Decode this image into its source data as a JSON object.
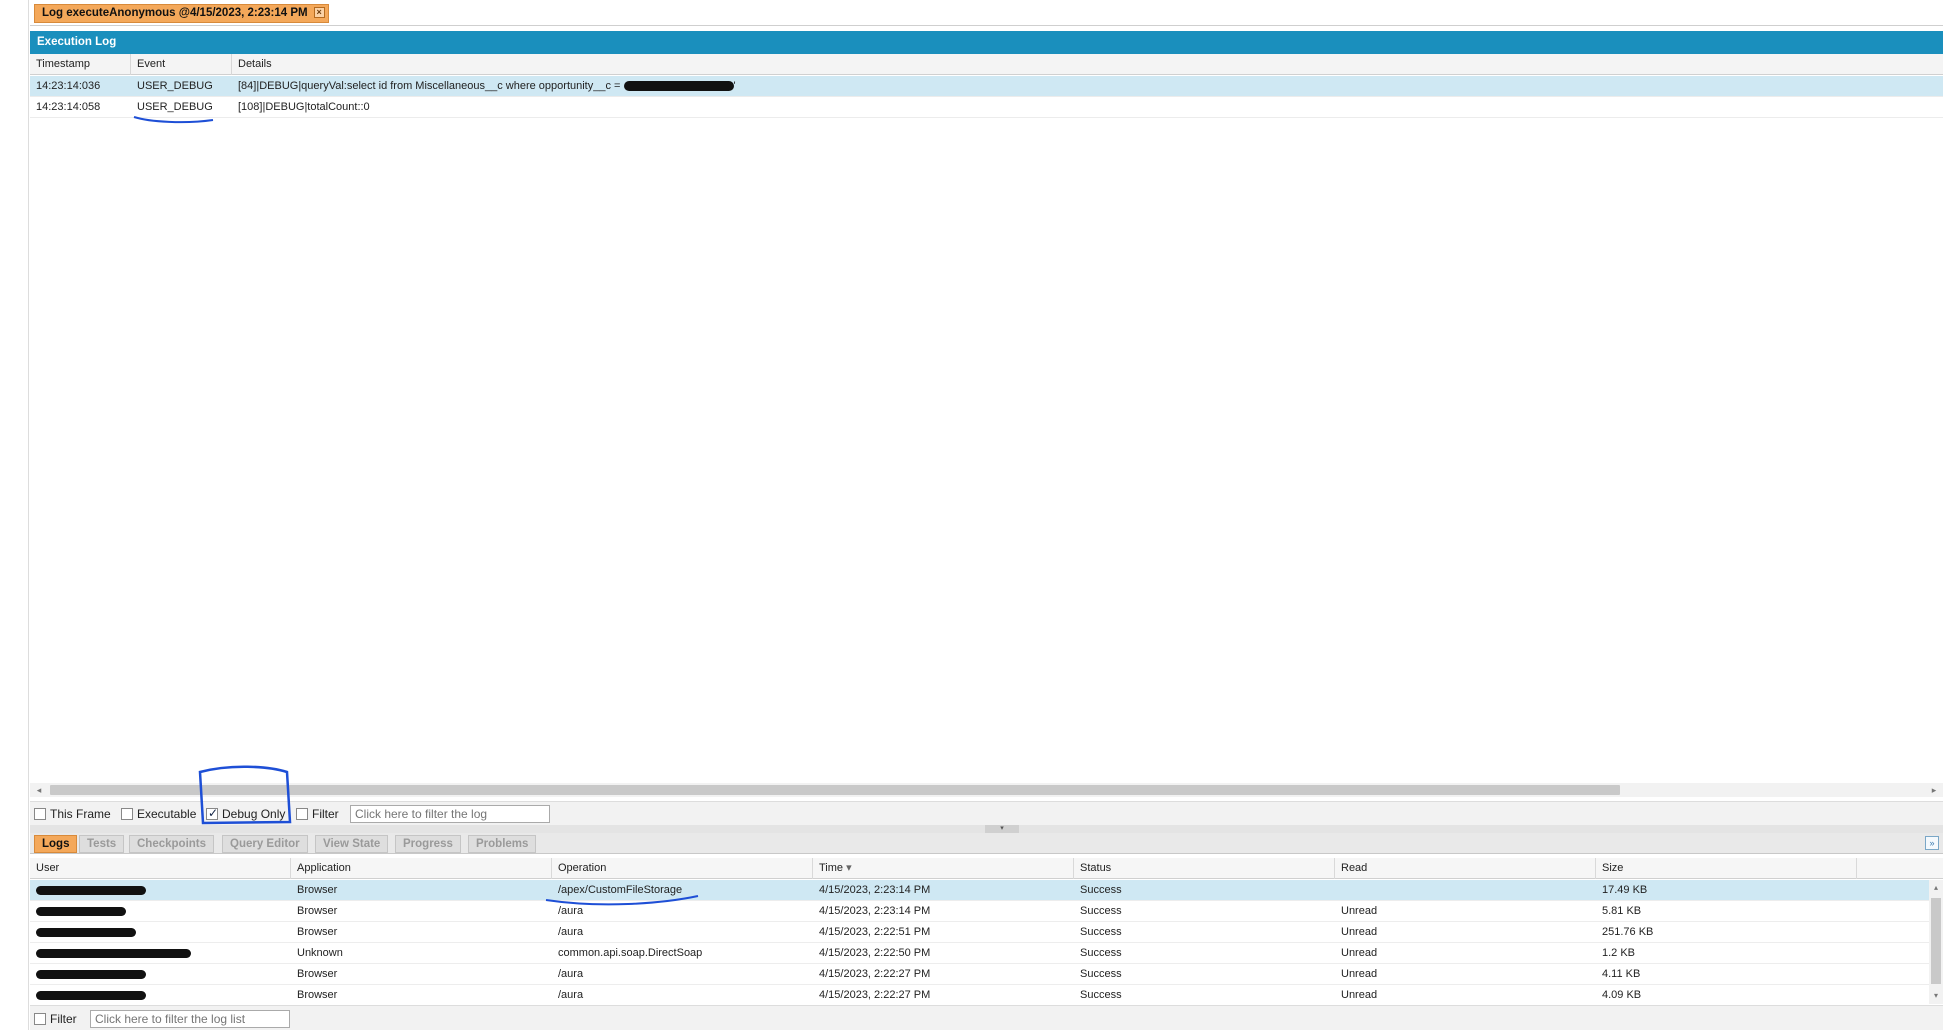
{
  "log_tab": {
    "title": "Log executeAnonymous @4/15/2023, 2:23:14 PM",
    "close": "×"
  },
  "execution_log": {
    "title": "Execution Log",
    "columns": [
      "Timestamp",
      "Event",
      "Details"
    ],
    "rows": [
      {
        "timestamp": "14:23:14:036",
        "event": "USER_DEBUG",
        "details": "[84]|DEBUG|queryVal:select id from Miscellaneous__c where opportunity__c = ",
        "details_tail": "'"
      },
      {
        "timestamp": "14:23:14:058",
        "event": "USER_DEBUG",
        "details": "[108]|DEBUG|totalCount::0"
      }
    ]
  },
  "exec_filters": {
    "this_frame": "This Frame",
    "executable": "Executable",
    "debug_only": "Debug Only",
    "debug_only_checked": true,
    "filter": "Filter",
    "filter_placeholder": "Click here to filter the log"
  },
  "bottom_tabs": [
    "Logs",
    "Tests",
    "Checkpoints",
    "Query Editor",
    "View State",
    "Progress",
    "Problems"
  ],
  "logs_table": {
    "columns": [
      "User",
      "Application",
      "Operation",
      "Time",
      "Status",
      "Read",
      "Size"
    ],
    "sort_indicator": "▾",
    "rows": [
      {
        "application": "Browser",
        "operation": "/apex/CustomFileStorage",
        "time": "4/15/2023, 2:23:14 PM",
        "status": "Success",
        "read": "",
        "size": "17.49 KB"
      },
      {
        "application": "Browser",
        "operation": "/aura",
        "time": "4/15/2023, 2:23:14 PM",
        "status": "Success",
        "read": "Unread",
        "size": "5.81 KB"
      },
      {
        "application": "Browser",
        "operation": "/aura",
        "time": "4/15/2023, 2:22:51 PM",
        "status": "Success",
        "read": "Unread",
        "size": "251.76 KB"
      },
      {
        "application": "Unknown",
        "operation": "common.api.soap.DirectSoap",
        "time": "4/15/2023, 2:22:50 PM",
        "status": "Success",
        "read": "Unread",
        "size": "1.2 KB"
      },
      {
        "application": "Browser",
        "operation": "/aura",
        "time": "4/15/2023, 2:22:27 PM",
        "status": "Success",
        "read": "Unread",
        "size": "4.11 KB"
      },
      {
        "application": "Browser",
        "operation": "/aura",
        "time": "4/15/2023, 2:22:27 PM",
        "status": "Success",
        "read": "Unread",
        "size": "4.09 KB"
      }
    ]
  },
  "log_filter": {
    "filter": "Filter",
    "placeholder": "Click here to filter the log list"
  },
  "colors": {
    "header_blue": "#1a8fbd",
    "tab_orange": "#f4a85a",
    "selected_row": "#cfe8f3",
    "annotation_blue": "#1e4fd6"
  }
}
